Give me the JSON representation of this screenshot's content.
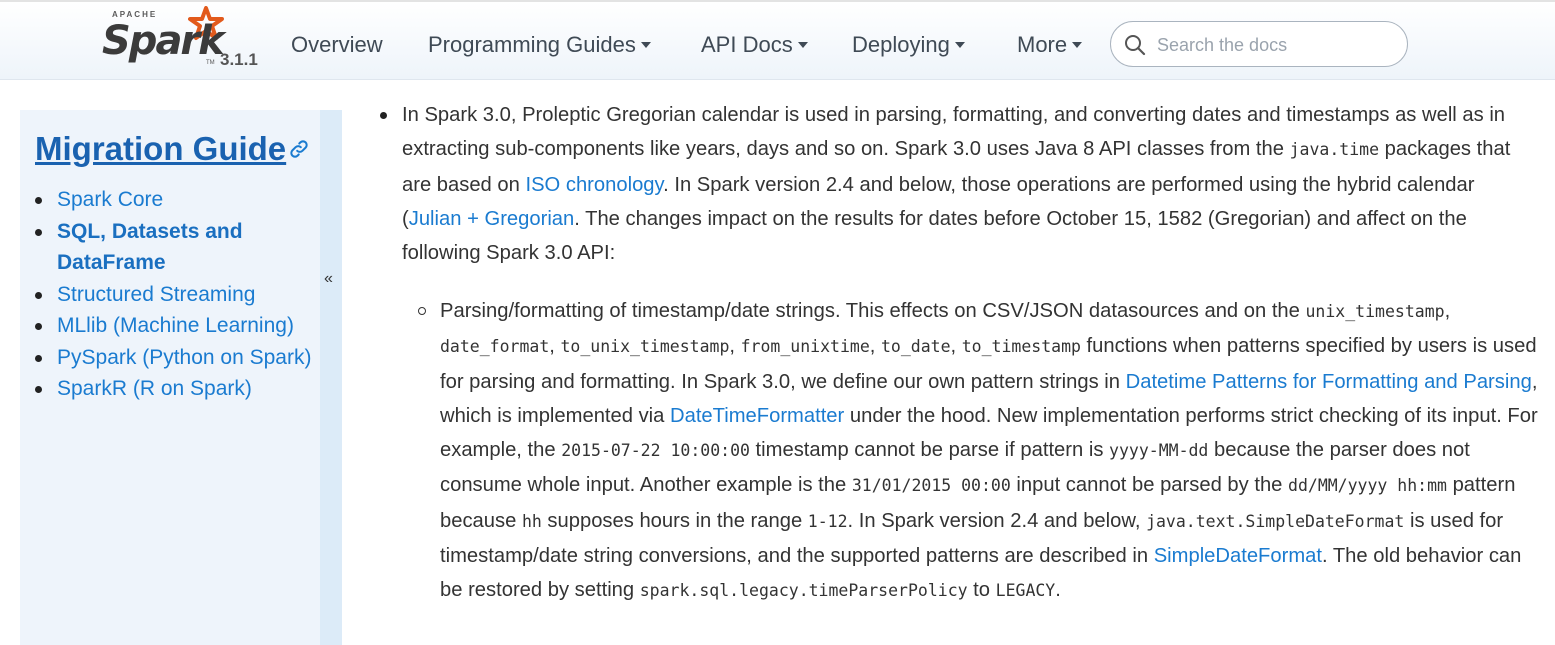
{
  "header": {
    "logo_top": "APACHE",
    "logo_word": "Spark",
    "logo_tm": "TM",
    "version": "3.1.1",
    "nav": [
      {
        "label": "Overview",
        "has_dropdown": false
      },
      {
        "label": "Programming Guides",
        "has_dropdown": true
      },
      {
        "label": "API Docs",
        "has_dropdown": true
      },
      {
        "label": "Deploying",
        "has_dropdown": true
      },
      {
        "label": "More",
        "has_dropdown": true
      }
    ],
    "search_placeholder": "Search the docs"
  },
  "sidebar": {
    "title": "Migration Guide",
    "toggle": "«",
    "items": [
      {
        "label": "Spark Core",
        "active": false
      },
      {
        "label": "SQL, Datasets and DataFrame",
        "active": true
      },
      {
        "label": "Structured Streaming",
        "active": false
      },
      {
        "label": "MLlib (Machine Learning)",
        "active": false
      },
      {
        "label": "PySpark (Python on Spark)",
        "active": false
      },
      {
        "label": "SparkR (R on Spark)",
        "active": false
      }
    ]
  },
  "main": {
    "p1": {
      "t1": "In Spark 3.0, Proleptic Gregorian calendar is used in parsing, formatting, and converting dates and timestamps as well as in extracting sub-components like years, days and so on. Spark 3.0 uses Java 8 API classes from the ",
      "c1": "java.time",
      "t2": " packages that are based on ",
      "l1": "ISO chronology",
      "t3": ". In Spark version 2.4 and below, those operations are performed using the hybrid calendar (",
      "l2": "Julian + Gregorian",
      "t4": ". The changes impact on the results for dates before October 15, 1582 (Gregorian) and affect on the following Spark 3.0 API:"
    },
    "p2": {
      "t1": "Parsing/formatting of timestamp/date strings. This effects on CSV/JSON datasources and on the ",
      "c1": "unix_timestamp",
      "t2": ", ",
      "c2": "date_format",
      "t3": ", ",
      "c3": "to_unix_timestamp",
      "t4": ", ",
      "c4": "from_unixtime",
      "t5": ", ",
      "c5": "to_date",
      "t6": ", ",
      "c6": "to_timestamp",
      "t7": " functions when patterns specified by users is used for parsing and formatting. In Spark 3.0, we define our own pattern strings in ",
      "l1": "Datetime Patterns for Formatting and Parsing",
      "t8": ", which is implemented via ",
      "l2": "DateTimeFormatter",
      "t9": " under the hood. New implementation performs strict checking of its input. For example, the ",
      "c7": "2015-07-22 10:00:00",
      "t10": " timestamp cannot be parse if pattern is ",
      "c8": "yyyy-MM-dd",
      "t11": " because the parser does not consume whole input. Another example is the ",
      "c9": "31/01/2015 00:00",
      "t12": " input cannot be parsed by the ",
      "c10": "dd/MM/yyyy hh:mm",
      "t13": " pattern because ",
      "c11": "hh",
      "t14": " supposes hours in the range ",
      "c12": "1-12",
      "t15": ". In Spark version 2.4 and below, ",
      "c13": "java.text.SimpleDateFormat",
      "t16": " is used for timestamp/date string conversions, and the supported patterns are described in ",
      "l3": "SimpleDateFormat",
      "t17": ". The old behavior can be restored by setting ",
      "c14": "spark.sql.legacy.timeParserPolicy",
      "t18": " to ",
      "c15": "LEGACY",
      "t19": "."
    }
  },
  "colors": {
    "link": "#1a7bd0",
    "title": "#1a62b0",
    "sidebar_bg": "#eef4fb",
    "spark_orange": "#e25a1c"
  }
}
